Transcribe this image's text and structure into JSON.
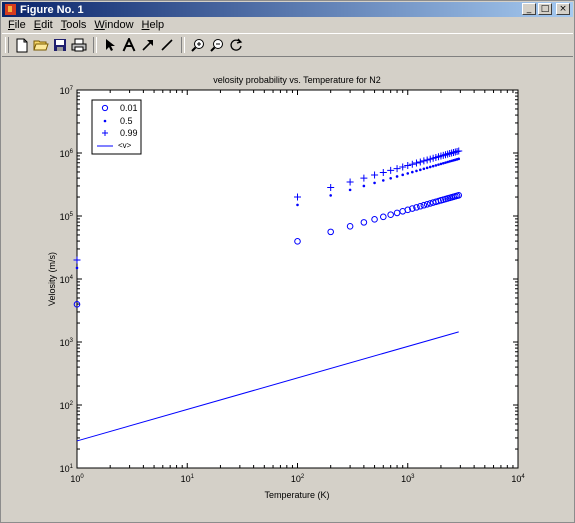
{
  "window": {
    "title": "Figure No. 1",
    "buttons": {
      "minimize": "_",
      "maximize": "□",
      "close": "×"
    }
  },
  "menu": [
    {
      "label": "File",
      "ul": "F",
      "rest": "ile"
    },
    {
      "label": "Edit",
      "ul": "E",
      "rest": "dit"
    },
    {
      "label": "Tools",
      "ul": "T",
      "rest": "ools"
    },
    {
      "label": "Window",
      "ul": "W",
      "rest": "indow"
    },
    {
      "label": "Help",
      "ul": "H",
      "rest": "elp"
    }
  ],
  "toolbar": {
    "icons": [
      "new-file-icon",
      "open-folder-icon",
      "save-icon",
      "print-icon",
      "pointer-arrow-icon",
      "text-icon",
      "arrow-icon",
      "line-icon",
      "zoom-in-icon",
      "zoom-out-icon",
      "rotate-3d-icon"
    ]
  },
  "chart_data": {
    "type": "scatter",
    "title": "velosity probability vs. Temperature for N2",
    "xlabel": "Temperature (K)",
    "ylabel": "Velosity (m/s)",
    "xscale": "log",
    "yscale": "log",
    "xlim": [
      1,
      10000
    ],
    "ylim": [
      10,
      10000000
    ],
    "x_tick_labels": [
      "10^0",
      "10^1",
      "10^2",
      "10^3",
      "10^4"
    ],
    "y_tick_labels": [
      "10^1",
      "10^2",
      "10^3",
      "10^4",
      "10^5",
      "10^6",
      "10^7"
    ],
    "legend_position": "top-left",
    "x": [
      1,
      100,
      200,
      300,
      400,
      500,
      600,
      700,
      800,
      900,
      1000,
      1100,
      1200,
      1300,
      1400,
      1500,
      1600,
      1700,
      1800,
      1900,
      2000,
      2100,
      2200,
      2300,
      2400,
      2500,
      2600,
      2700,
      2800,
      2900
    ],
    "series": [
      {
        "name": "0.01",
        "marker": "o",
        "color": "#0000ff",
        "values": [
          3960,
          39600,
          56000,
          68600,
          79200,
          88500,
          97000,
          104800,
          112000,
          118800,
          125200,
          131300,
          137100,
          142800,
          148200,
          153400,
          158400,
          163300,
          168000,
          172600,
          177100,
          181400,
          185700,
          189900,
          194000,
          198000,
          201900,
          205800,
          209600,
          213300
        ]
      },
      {
        "name": "0.5",
        "marker": ".",
        "color": "#0000ff",
        "values": [
          15000,
          150000,
          212100,
          259800,
          300000,
          335400,
          367400,
          396900,
          424300,
          450000,
          474300,
          497500,
          519600,
          540800,
          561200,
          580900,
          600000,
          618500,
          636400,
          653800,
          670800,
          687400,
          703600,
          719400,
          734800,
          750000,
          764900,
          779400,
          793700,
          807800
        ]
      },
      {
        "name": "0.99",
        "marker": "+",
        "color": "#0000ff",
        "values": [
          20000,
          200000,
          282800,
          346400,
          400000,
          447200,
          489900,
          529200,
          565700,
          600000,
          632500,
          663300,
          692800,
          721100,
          748300,
          774600,
          800000,
          824600,
          848500,
          871800,
          894400,
          916500,
          938100,
          959200,
          979800,
          1000000,
          1019800,
          1039200,
          1058300,
          1077000
        ]
      },
      {
        "name": "<v>",
        "marker": "line",
        "color": "#0000ff",
        "x": [
          1,
          2900
        ],
        "values": [
          26.9,
          1449
        ]
      }
    ]
  }
}
